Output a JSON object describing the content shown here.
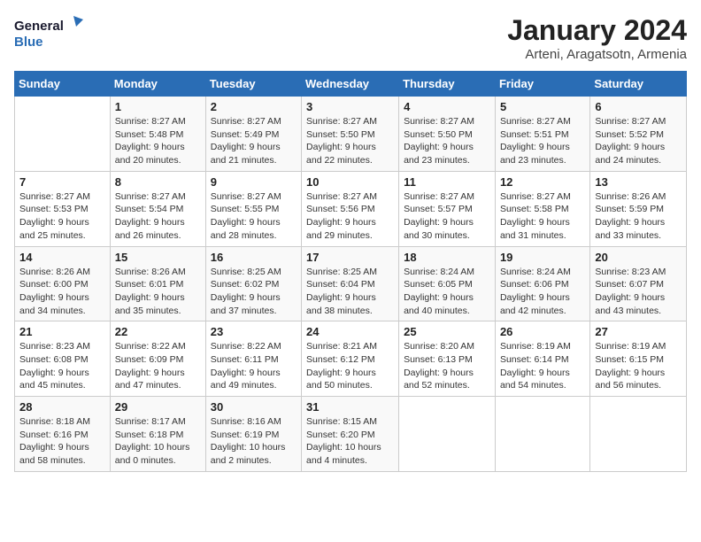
{
  "logo": {
    "line1": "General",
    "line2": "Blue"
  },
  "title": "January 2024",
  "subtitle": "Arteni, Aragatsotn, Armenia",
  "days_of_week": [
    "Sunday",
    "Monday",
    "Tuesday",
    "Wednesday",
    "Thursday",
    "Friday",
    "Saturday"
  ],
  "weeks": [
    [
      {
        "day": "",
        "info": ""
      },
      {
        "day": "1",
        "info": "Sunrise: 8:27 AM\nSunset: 5:48 PM\nDaylight: 9 hours\nand 20 minutes."
      },
      {
        "day": "2",
        "info": "Sunrise: 8:27 AM\nSunset: 5:49 PM\nDaylight: 9 hours\nand 21 minutes."
      },
      {
        "day": "3",
        "info": "Sunrise: 8:27 AM\nSunset: 5:50 PM\nDaylight: 9 hours\nand 22 minutes."
      },
      {
        "day": "4",
        "info": "Sunrise: 8:27 AM\nSunset: 5:50 PM\nDaylight: 9 hours\nand 23 minutes."
      },
      {
        "day": "5",
        "info": "Sunrise: 8:27 AM\nSunset: 5:51 PM\nDaylight: 9 hours\nand 23 minutes."
      },
      {
        "day": "6",
        "info": "Sunrise: 8:27 AM\nSunset: 5:52 PM\nDaylight: 9 hours\nand 24 minutes."
      }
    ],
    [
      {
        "day": "7",
        "info": "Sunrise: 8:27 AM\nSunset: 5:53 PM\nDaylight: 9 hours\nand 25 minutes."
      },
      {
        "day": "8",
        "info": "Sunrise: 8:27 AM\nSunset: 5:54 PM\nDaylight: 9 hours\nand 26 minutes."
      },
      {
        "day": "9",
        "info": "Sunrise: 8:27 AM\nSunset: 5:55 PM\nDaylight: 9 hours\nand 28 minutes."
      },
      {
        "day": "10",
        "info": "Sunrise: 8:27 AM\nSunset: 5:56 PM\nDaylight: 9 hours\nand 29 minutes."
      },
      {
        "day": "11",
        "info": "Sunrise: 8:27 AM\nSunset: 5:57 PM\nDaylight: 9 hours\nand 30 minutes."
      },
      {
        "day": "12",
        "info": "Sunrise: 8:27 AM\nSunset: 5:58 PM\nDaylight: 9 hours\nand 31 minutes."
      },
      {
        "day": "13",
        "info": "Sunrise: 8:26 AM\nSunset: 5:59 PM\nDaylight: 9 hours\nand 33 minutes."
      }
    ],
    [
      {
        "day": "14",
        "info": "Sunrise: 8:26 AM\nSunset: 6:00 PM\nDaylight: 9 hours\nand 34 minutes."
      },
      {
        "day": "15",
        "info": "Sunrise: 8:26 AM\nSunset: 6:01 PM\nDaylight: 9 hours\nand 35 minutes."
      },
      {
        "day": "16",
        "info": "Sunrise: 8:25 AM\nSunset: 6:02 PM\nDaylight: 9 hours\nand 37 minutes."
      },
      {
        "day": "17",
        "info": "Sunrise: 8:25 AM\nSunset: 6:04 PM\nDaylight: 9 hours\nand 38 minutes."
      },
      {
        "day": "18",
        "info": "Sunrise: 8:24 AM\nSunset: 6:05 PM\nDaylight: 9 hours\nand 40 minutes."
      },
      {
        "day": "19",
        "info": "Sunrise: 8:24 AM\nSunset: 6:06 PM\nDaylight: 9 hours\nand 42 minutes."
      },
      {
        "day": "20",
        "info": "Sunrise: 8:23 AM\nSunset: 6:07 PM\nDaylight: 9 hours\nand 43 minutes."
      }
    ],
    [
      {
        "day": "21",
        "info": "Sunrise: 8:23 AM\nSunset: 6:08 PM\nDaylight: 9 hours\nand 45 minutes."
      },
      {
        "day": "22",
        "info": "Sunrise: 8:22 AM\nSunset: 6:09 PM\nDaylight: 9 hours\nand 47 minutes."
      },
      {
        "day": "23",
        "info": "Sunrise: 8:22 AM\nSunset: 6:11 PM\nDaylight: 9 hours\nand 49 minutes."
      },
      {
        "day": "24",
        "info": "Sunrise: 8:21 AM\nSunset: 6:12 PM\nDaylight: 9 hours\nand 50 minutes."
      },
      {
        "day": "25",
        "info": "Sunrise: 8:20 AM\nSunset: 6:13 PM\nDaylight: 9 hours\nand 52 minutes."
      },
      {
        "day": "26",
        "info": "Sunrise: 8:19 AM\nSunset: 6:14 PM\nDaylight: 9 hours\nand 54 minutes."
      },
      {
        "day": "27",
        "info": "Sunrise: 8:19 AM\nSunset: 6:15 PM\nDaylight: 9 hours\nand 56 minutes."
      }
    ],
    [
      {
        "day": "28",
        "info": "Sunrise: 8:18 AM\nSunset: 6:16 PM\nDaylight: 9 hours\nand 58 minutes."
      },
      {
        "day": "29",
        "info": "Sunrise: 8:17 AM\nSunset: 6:18 PM\nDaylight: 10 hours\nand 0 minutes."
      },
      {
        "day": "30",
        "info": "Sunrise: 8:16 AM\nSunset: 6:19 PM\nDaylight: 10 hours\nand 2 minutes."
      },
      {
        "day": "31",
        "info": "Sunrise: 8:15 AM\nSunset: 6:20 PM\nDaylight: 10 hours\nand 4 minutes."
      },
      {
        "day": "",
        "info": ""
      },
      {
        "day": "",
        "info": ""
      },
      {
        "day": "",
        "info": ""
      }
    ]
  ]
}
